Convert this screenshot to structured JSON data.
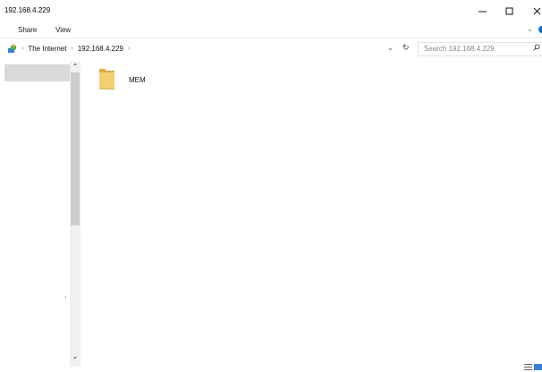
{
  "window": {
    "title": "192.168.4.229"
  },
  "ribbon": {
    "tabs": [
      "Share",
      "View"
    ]
  },
  "address_bar": {
    "root": "The Internet",
    "current": "192.168.4.229"
  },
  "search": {
    "placeholder": "Search 192.168.4.229"
  },
  "content": {
    "items": [
      {
        "name": "MEM",
        "icon": "folder-icon"
      }
    ]
  },
  "colors": {
    "accent": "#1673c9",
    "folder": "#e8b84a"
  }
}
